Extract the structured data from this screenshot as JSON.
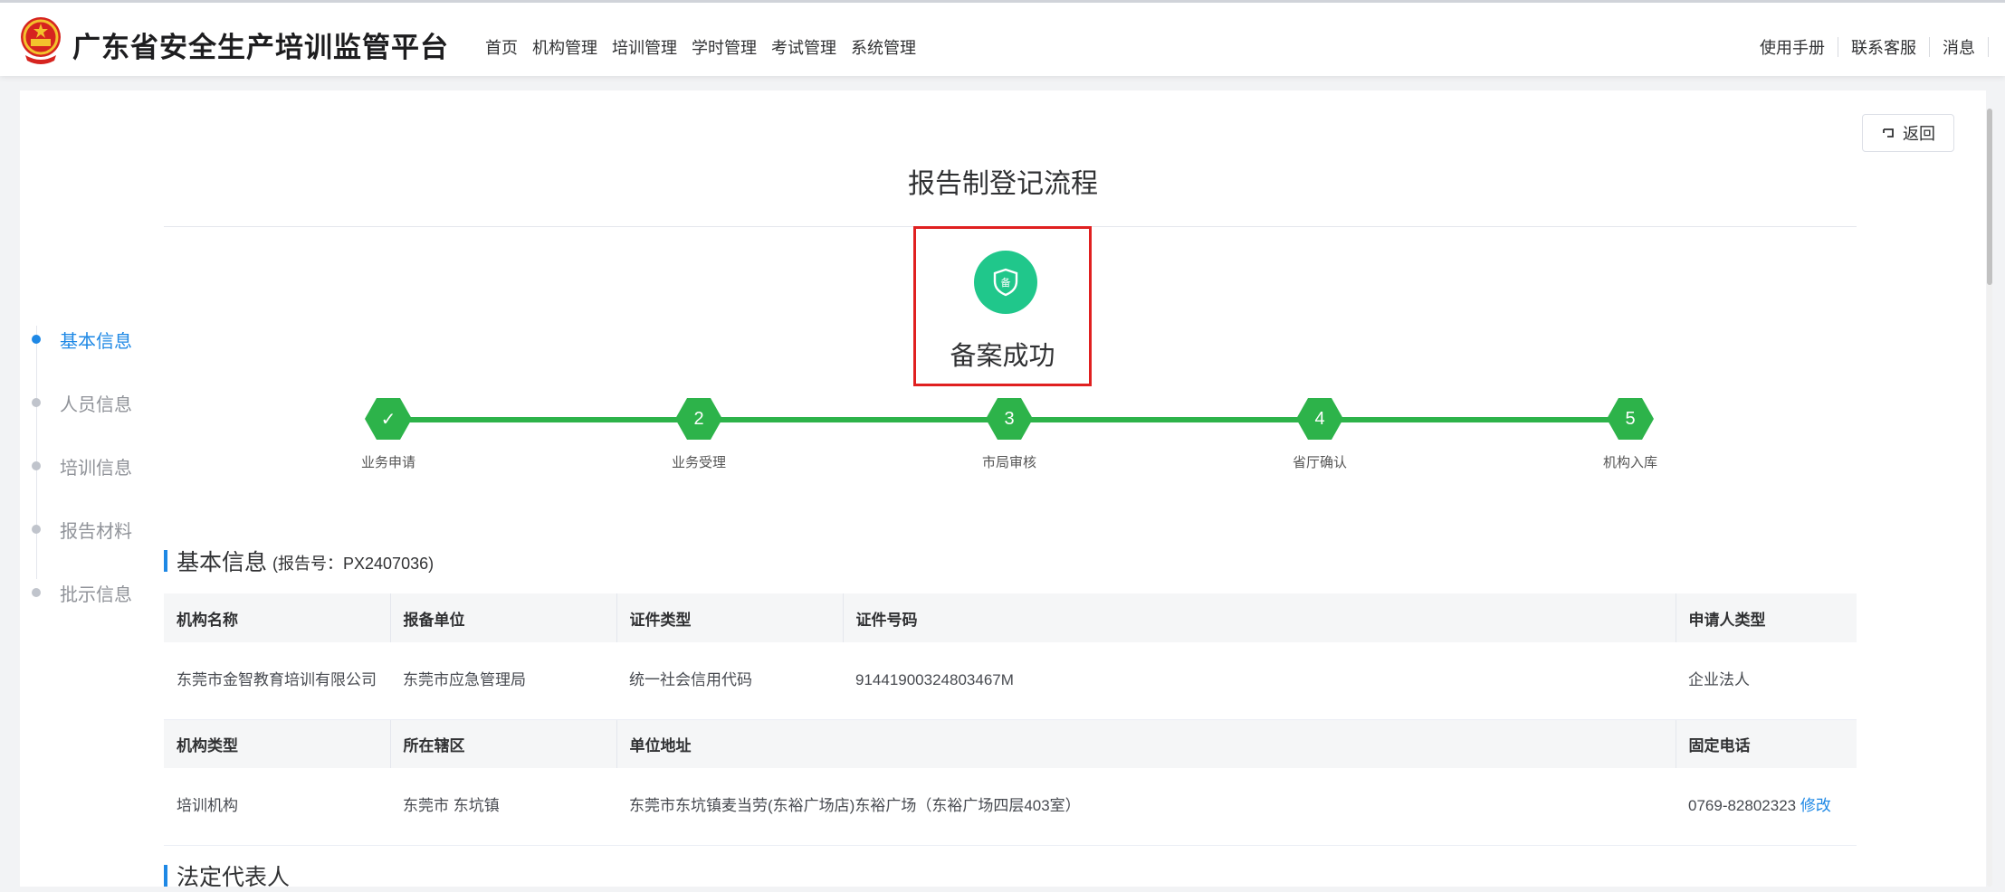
{
  "header": {
    "app_title": "广东省安全生产培训监管平台",
    "nav": [
      "首页",
      "机构管理",
      "培训管理",
      "学时管理",
      "考试管理",
      "系统管理"
    ],
    "right_links": [
      "使用手册",
      "联系客服",
      "消息"
    ]
  },
  "page": {
    "back_label": "返回",
    "title": "报告制登记流程",
    "status_text": "备案成功",
    "status_icon_glyph": "备"
  },
  "steps": [
    {
      "marker": "✓",
      "label": "业务申请"
    },
    {
      "marker": "2",
      "label": "业务受理"
    },
    {
      "marker": "3",
      "label": "市局审核"
    },
    {
      "marker": "4",
      "label": "省厅确认"
    },
    {
      "marker": "5",
      "label": "机构入库"
    }
  ],
  "side_nav": [
    {
      "label": "基本信息",
      "active": true
    },
    {
      "label": "人员信息",
      "active": false
    },
    {
      "label": "培训信息",
      "active": false
    },
    {
      "label": "报告材料",
      "active": false
    },
    {
      "label": "批示信息",
      "active": false
    }
  ],
  "basic_info": {
    "section_title": "基本信息",
    "report_no": "(报告号：PX2407036)",
    "headers_row1": [
      "机构名称",
      "报备单位",
      "证件类型",
      "证件号码",
      "申请人类型"
    ],
    "values_row1": [
      "东莞市金智教育培训有限公司",
      "东莞市应急管理局",
      "统一社会信用代码",
      "91441900324803467M",
      "企业法人"
    ],
    "headers_row2": [
      "机构类型",
      "所在辖区",
      "单位地址",
      "固定电话"
    ],
    "values_row2": [
      "培训机构",
      "东莞市 东坑镇",
      "东莞市东坑镇麦当劳(东裕广场店)东裕广场（东裕广场四层403室）",
      "0769-82802323"
    ],
    "edit_label": "修改"
  },
  "next_section": {
    "title": "法定代表人"
  },
  "colors": {
    "accent": "#1e88e5",
    "step_green": "#2db34a",
    "status_green": "#20c78b",
    "highlight_red": "#e02020"
  }
}
